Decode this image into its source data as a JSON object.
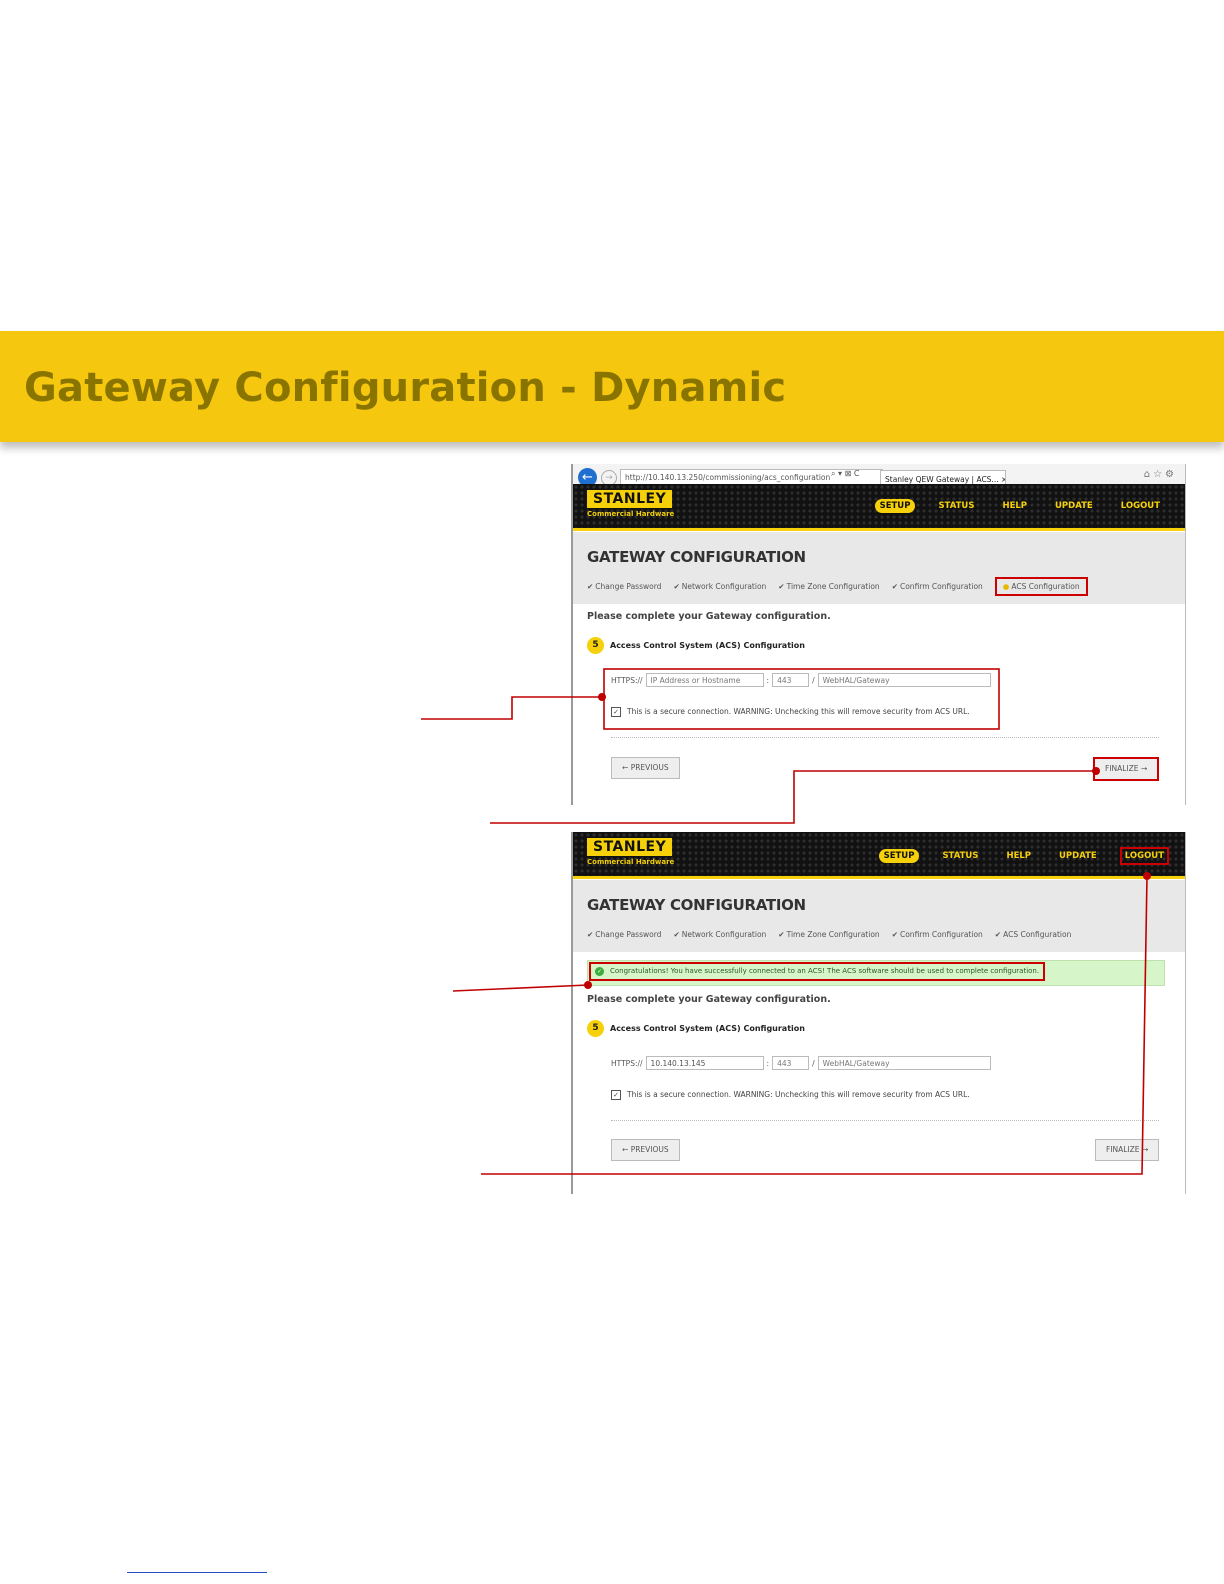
{
  "banner": {
    "title": "Gateway Configuration - Dynamic"
  },
  "browser": {
    "address": "http://10.140.13.250/commissioning/acs_configuration",
    "address_icons": "⌕ ▾ ⊠ C",
    "tab_title": "Stanley QEW Gateway | ACS... ×"
  },
  "app": {
    "logo": "STANLEY",
    "logo_sub": "Commercial Hardware",
    "nav": [
      "SETUP",
      "STATUS",
      "HELP",
      "UPDATE",
      "LOGOUT"
    ],
    "page_title": "GATEWAY CONFIGURATION",
    "steps": [
      "Change Password",
      "Network Configuration",
      "Time Zone Configuration",
      "Confirm Configuration",
      "ACS Configuration"
    ],
    "intro": "Please complete your Gateway configuration.",
    "section_number": "5",
    "section_title": "Access Control System (ACS) Configuration",
    "https_label": "HTTPS://",
    "colon": ":",
    "slash": "/",
    "secure_note": "This is a secure connection. WARNING: Unchecking this will remove security from ACS URL.",
    "previous_label": "PREVIOUS",
    "finalize_label": "FINALIZE"
  },
  "screen1": {
    "host_placeholder": "IP Address or Hostname",
    "port_value": "443",
    "path_value": "WebHAL/Gateway"
  },
  "screen2": {
    "success_message": "Congratulations! You have successfully connected to an ACS! The ACS software should be used to complete configuration.",
    "host_value": "10.140.13.145",
    "port_value": "443",
    "path_value": "WebHAL/Gateway"
  },
  "colors": {
    "banner": "#f6c70f",
    "brand_yellow": "#f6d10a",
    "callout_red": "#c00000"
  }
}
